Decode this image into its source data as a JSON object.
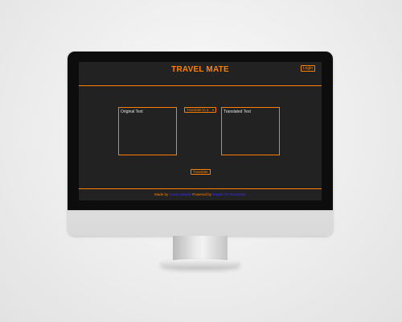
{
  "app": {
    "title": "TRAVEL MATE",
    "login_label": "Login"
  },
  "translator": {
    "original_placeholder": "Original Text",
    "translated_placeholder": "Translated Text",
    "language_select_value": "Translate to a",
    "translate_label": "Translate"
  },
  "footer": {
    "made_by_prefix": "Made by ",
    "author_link": "Kunal Jaiswal",
    "powered_by_prefix": " Powered by ",
    "api_link": "Rapid-API Translator"
  },
  "colors": {
    "accent": "#ff8000",
    "screen_bg": "#222222",
    "link": "#3a2bff"
  },
  "icons": {
    "select_chevron": "chevron-down-icon"
  }
}
